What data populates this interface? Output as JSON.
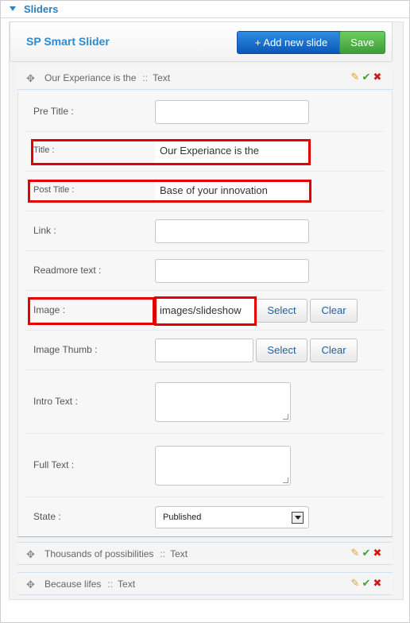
{
  "panel": {
    "title": "Sliders"
  },
  "header": {
    "brand": "SP Smart Slider",
    "add_label": "+ Add new slide",
    "save_label": "Save"
  },
  "slides": [
    {
      "title": "Our Experiance is the",
      "sep": "::",
      "type": "Text"
    },
    {
      "title": "Thousands of possibilities",
      "sep": "::",
      "type": "Text"
    },
    {
      "title": "Because lifes",
      "sep": "::",
      "type": "Text"
    }
  ],
  "form": {
    "pre_title": {
      "label": "Pre Title :",
      "value": ""
    },
    "title": {
      "label": "Title :",
      "value": "Our Experiance is the"
    },
    "post_title": {
      "label": "Post Title :",
      "value": "Base of your innovation"
    },
    "link": {
      "label": "Link :",
      "value": ""
    },
    "readmore": {
      "label": "Readmore text :",
      "value": ""
    },
    "image": {
      "label": "Image :",
      "value": "images/slideshow"
    },
    "image_thumb": {
      "label": "Image Thumb :",
      "value": ""
    },
    "intro_text": {
      "label": "Intro Text :"
    },
    "full_text": {
      "label": "Full Text :"
    },
    "state": {
      "label": "State :",
      "value": "Published"
    },
    "select_label": "Select",
    "clear_label": "Clear"
  },
  "icons": {
    "move": "move-icon",
    "edit": "pencil-icon",
    "ok": "check-icon",
    "delete": "delete-icon"
  },
  "colors": {
    "accent": "#2c7fbf",
    "add_button": "#0a58b8",
    "save_button": "#4aa83f",
    "highlight": "#e20000"
  }
}
